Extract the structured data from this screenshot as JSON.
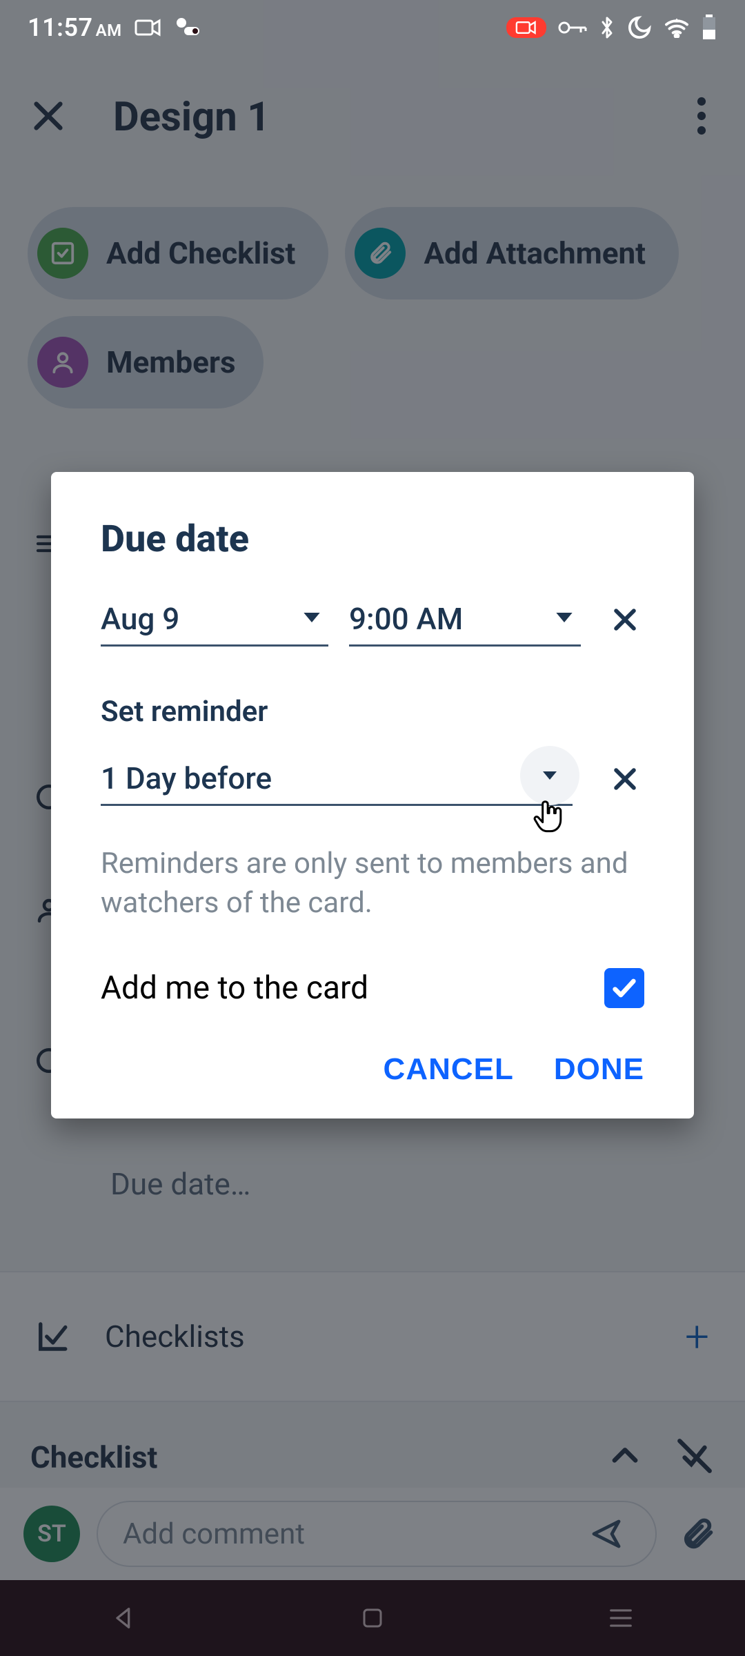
{
  "status": {
    "time": "11:57",
    "ampm": "AM"
  },
  "header": {
    "title": "Design 1"
  },
  "chips": {
    "checklist": "Add Checklist",
    "attachment": "Add Attachment",
    "members": "Members"
  },
  "background": {
    "due_placeholder": "Due date…",
    "checklists_label": "Checklists",
    "checklist_header": "Checklist"
  },
  "comment": {
    "avatar_initials": "ST",
    "placeholder": "Add comment"
  },
  "dialog": {
    "title": "Due date",
    "date_value": "Aug 9",
    "time_value": "9:00 AM",
    "set_reminder_label": "Set reminder",
    "reminder_value": "1 Day before",
    "hint": "Reminders are only sent to members and watchers of the card.",
    "add_me_label": "Add me to the card",
    "add_me_checked": true,
    "cancel": "CANCEL",
    "done": "DONE"
  }
}
